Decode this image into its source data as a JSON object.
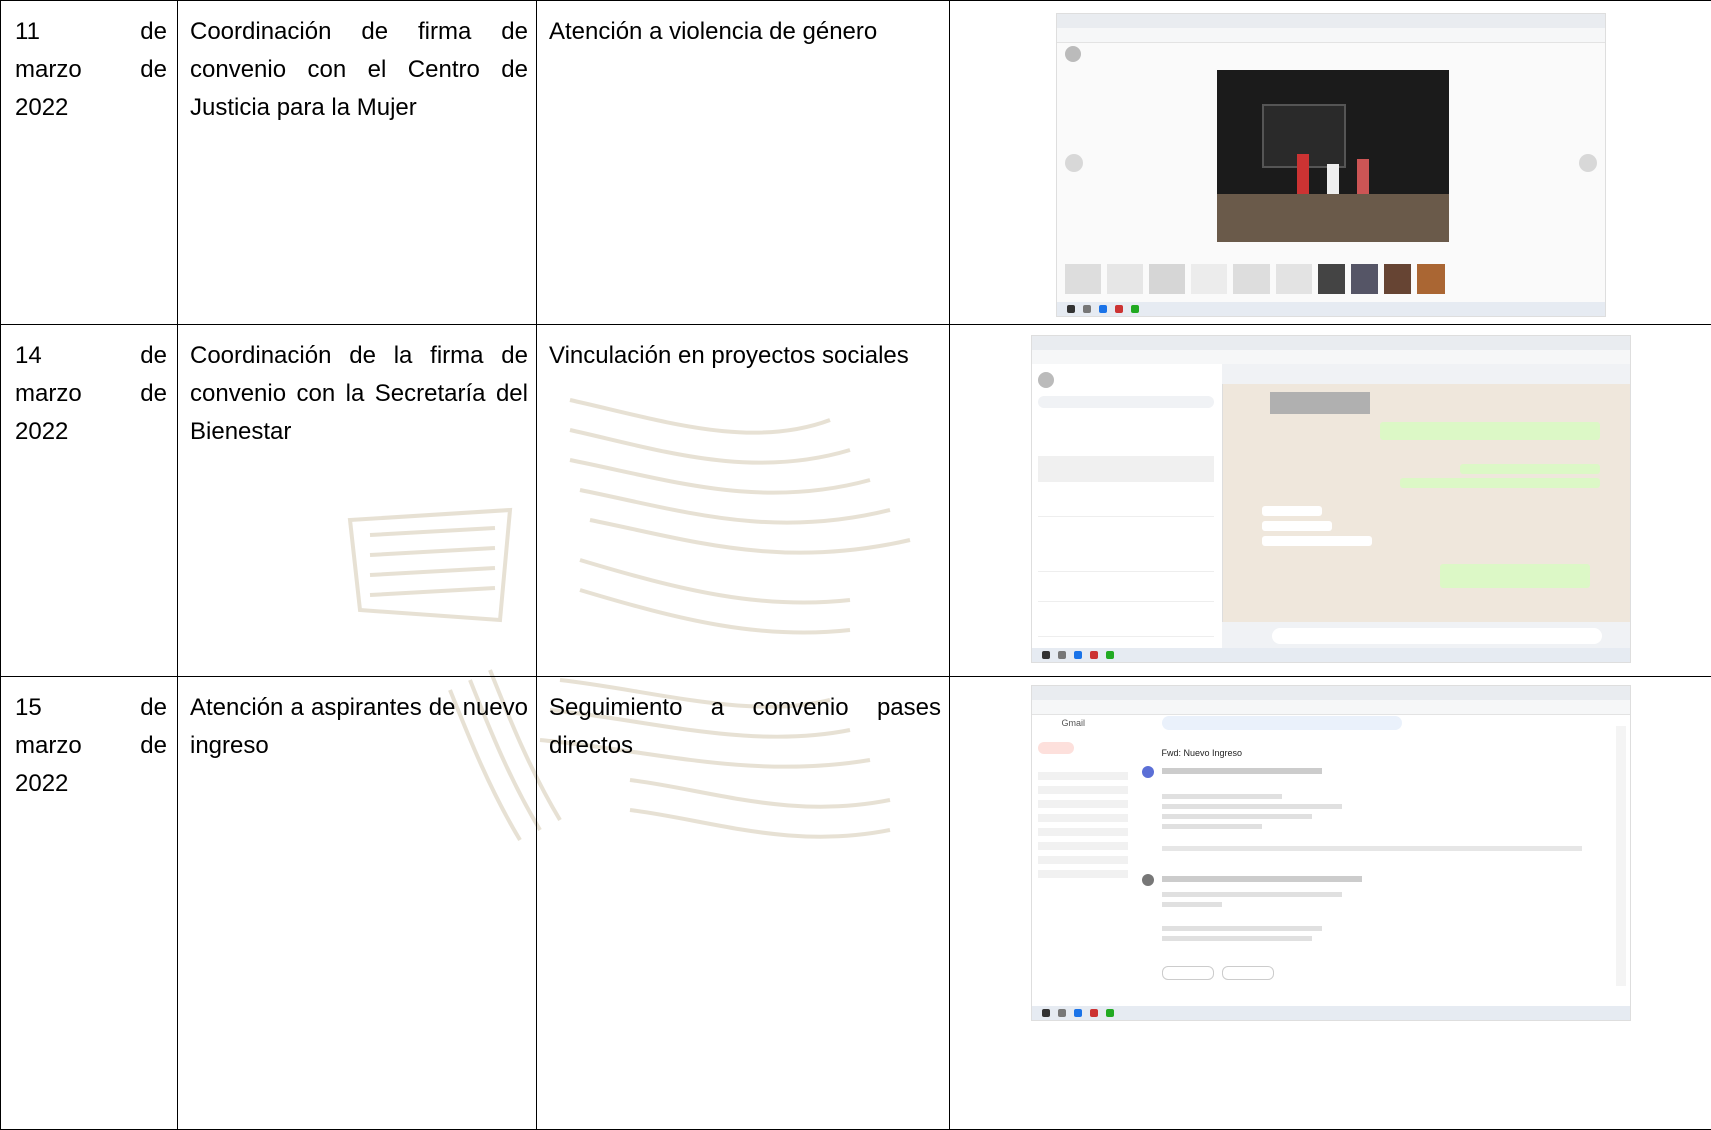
{
  "rows": [
    {
      "date": {
        "day": "11",
        "de1": "de",
        "month": "marzo",
        "de2": "de",
        "year": "2022"
      },
      "activity": "Coordinación de firma de convenio con el Centro de Justicia para la Mujer",
      "area": "Atención a violencia de género",
      "screenshot": {
        "kind": "photo-viewer",
        "caption": "Gmail photo viewer showing an event photo"
      }
    },
    {
      "date": {
        "day": "14",
        "de1": "de",
        "month": "marzo",
        "de2": "de",
        "year": "2022"
      },
      "activity": "Coordinación de la firma de convenio con la Secretaría del Bienestar",
      "area": "Vinculación en proyectos sociales",
      "screenshot": {
        "kind": "whatsapp-chat",
        "caption": "WhatsApp Web conversation"
      }
    },
    {
      "date": {
        "day": "15",
        "de1": "de",
        "month": "marzo",
        "de2": "de",
        "year": "2022"
      },
      "activity": "Atención a aspirantes de nuevo ingreso",
      "area": "Seguimiento a convenio pases directos",
      "screenshot": {
        "kind": "gmail-inbox",
        "caption": "Gmail email thread",
        "app": "Gmail",
        "subject": "Fwd: Nuevo Ingreso"
      }
    }
  ],
  "colors": {
    "border": "#000000",
    "watermark": "#c9bda0",
    "chat_green": "#dcf8c6"
  }
}
